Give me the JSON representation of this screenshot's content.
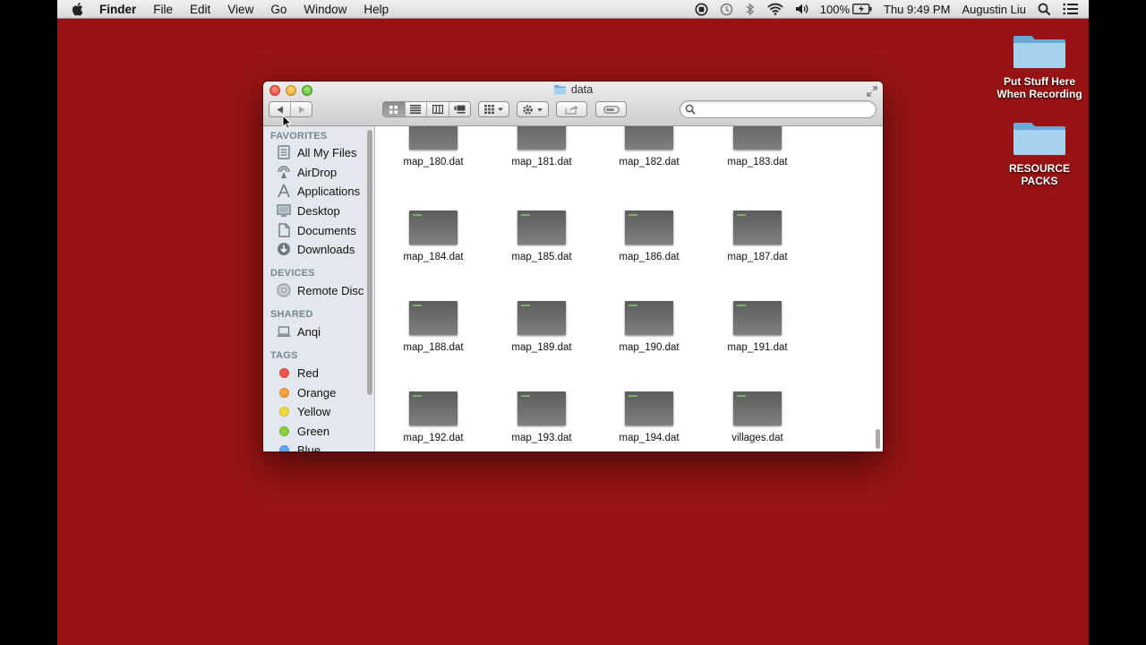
{
  "menubar": {
    "app": "Finder",
    "items": [
      "File",
      "Edit",
      "View",
      "Go",
      "Window",
      "Help"
    ],
    "battery": "100%",
    "clock": "Thu 9:49 PM",
    "user": "Augustin Liu",
    "icons": [
      "apple-icon",
      "recording-icon",
      "time-machine-icon",
      "bluetooth-icon",
      "wifi-icon",
      "volume-icon",
      "battery-icon",
      "spotlight-icon",
      "notification-center-icon"
    ]
  },
  "desktop": {
    "icons": [
      {
        "label": "Put Stuff Here\nWhen Recording"
      },
      {
        "label": "RESOURCE\nPACKS"
      }
    ]
  },
  "window": {
    "title": "data",
    "search": {
      "value": "",
      "placeholder": ""
    },
    "toolbar_icons": [
      "back-icon",
      "forward-icon",
      "icon-view-icon",
      "list-view-icon",
      "column-view-icon",
      "cover-flow-icon",
      "arrange-icon",
      "action-gear-icon",
      "share-icon",
      "tags-icon"
    ]
  },
  "sidebar": {
    "favorites_header": "FAVORITES",
    "favorites": [
      {
        "label": "All My Files"
      },
      {
        "label": "AirDrop"
      },
      {
        "label": "Applications"
      },
      {
        "label": "Desktop"
      },
      {
        "label": "Documents"
      },
      {
        "label": "Downloads"
      }
    ],
    "devices_header": "DEVICES",
    "devices": [
      {
        "label": "Remote Disc"
      }
    ],
    "shared_header": "SHARED",
    "shared": [
      {
        "label": "Anqi"
      }
    ],
    "tags_header": "TAGS",
    "tags": [
      {
        "label": "Red",
        "color": "#f2544e"
      },
      {
        "label": "Orange",
        "color": "#f6a33a"
      },
      {
        "label": "Yellow",
        "color": "#f3dc3a"
      },
      {
        "label": "Green",
        "color": "#8ccc3f"
      },
      {
        "label": "Blue",
        "color": "#5aa8f2"
      }
    ]
  },
  "files": [
    "map_180.dat",
    "map_181.dat",
    "map_182.dat",
    "map_183.dat",
    "map_184.dat",
    "map_185.dat",
    "map_186.dat",
    "map_187.dat",
    "map_188.dat",
    "map_189.dat",
    "map_190.dat",
    "map_191.dat",
    "map_192.dat",
    "map_193.dat",
    "map_194.dat",
    "villages.dat"
  ],
  "colors": {
    "desktop": "#981414",
    "sidebar": "#e3e8ee",
    "folder": "#8fc3e8"
  }
}
